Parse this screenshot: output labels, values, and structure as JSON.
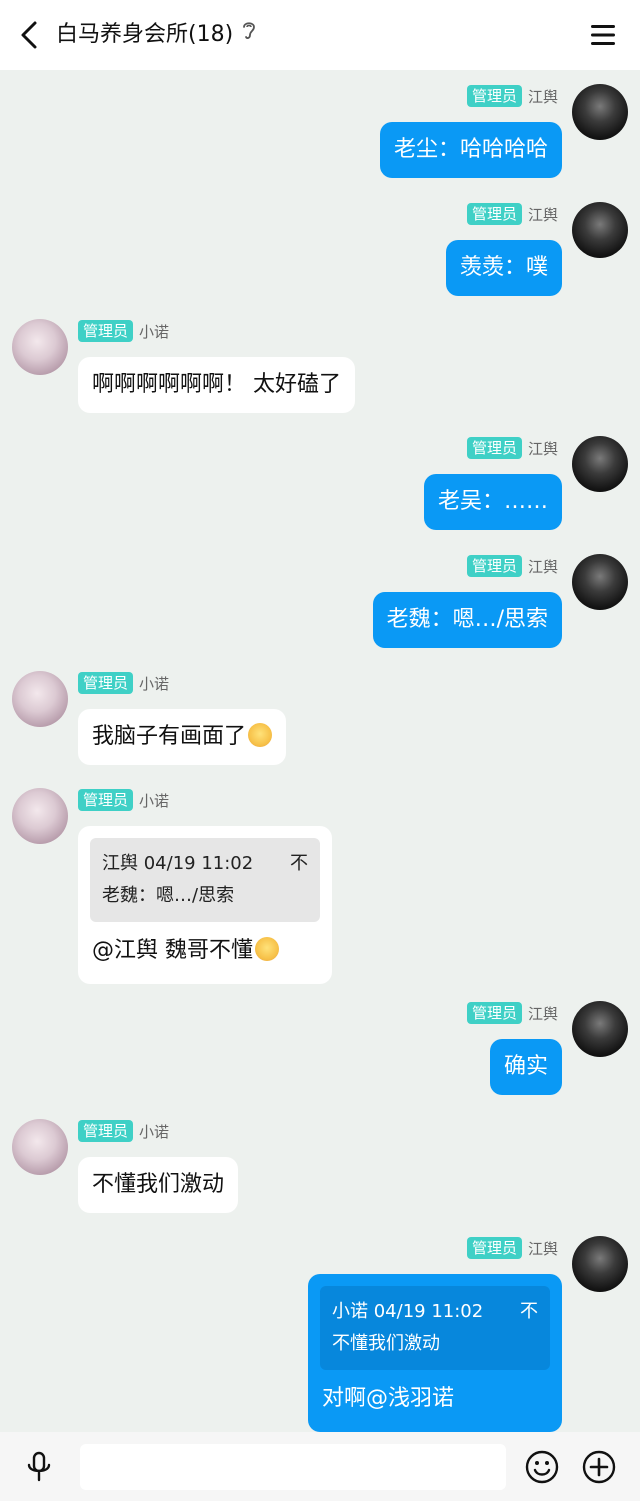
{
  "header": {
    "title": "白马养身会所(18)"
  },
  "messages": [
    {
      "side": "right",
      "role": "管理员",
      "sender": "江舆",
      "text": "老尘：哈哈哈哈"
    },
    {
      "side": "right",
      "role": "管理员",
      "sender": "江舆",
      "text": "羡羡：噗"
    },
    {
      "side": "left",
      "role": "管理员",
      "sender": "小诺",
      "text": "啊啊啊啊啊啊！ 太好磕了"
    },
    {
      "side": "right",
      "role": "管理员",
      "sender": "江舆",
      "text": "老吴：……"
    },
    {
      "side": "right",
      "role": "管理员",
      "sender": "江舆",
      "text": "老魏：嗯…/思索"
    },
    {
      "side": "left",
      "role": "管理员",
      "sender": "小诺",
      "text": "我脑子有画面了"
    },
    {
      "side": "left",
      "role": "管理员",
      "sender": "小诺",
      "quote": {
        "author": "江舆",
        "time": "04/19 11:02",
        "mark": "不",
        "text": "老魏：嗯…/思索"
      },
      "text": "@江舆 魏哥不懂"
    },
    {
      "side": "right",
      "role": "管理员",
      "sender": "江舆",
      "text": "确实"
    },
    {
      "side": "left",
      "role": "管理员",
      "sender": "小诺",
      "text": "不懂我们激动"
    },
    {
      "side": "right",
      "role": "管理员",
      "sender": "江舆",
      "quote": {
        "author": "小诺",
        "time": "04/19 11:02",
        "mark": "不",
        "text": "不懂我们激动"
      },
      "text": "对啊@浅羽诺"
    }
  ],
  "input": {
    "placeholder": ""
  },
  "icons": {
    "back": "back-arrow-icon",
    "ear": "ear-icon",
    "menu": "menu-icon",
    "mic": "microphone-icon",
    "smile": "emoji-icon",
    "plus": "plus-icon"
  },
  "colors": {
    "accent": "#0a99f5",
    "badge": "#3fd0c6",
    "background": "#edf1ee"
  }
}
